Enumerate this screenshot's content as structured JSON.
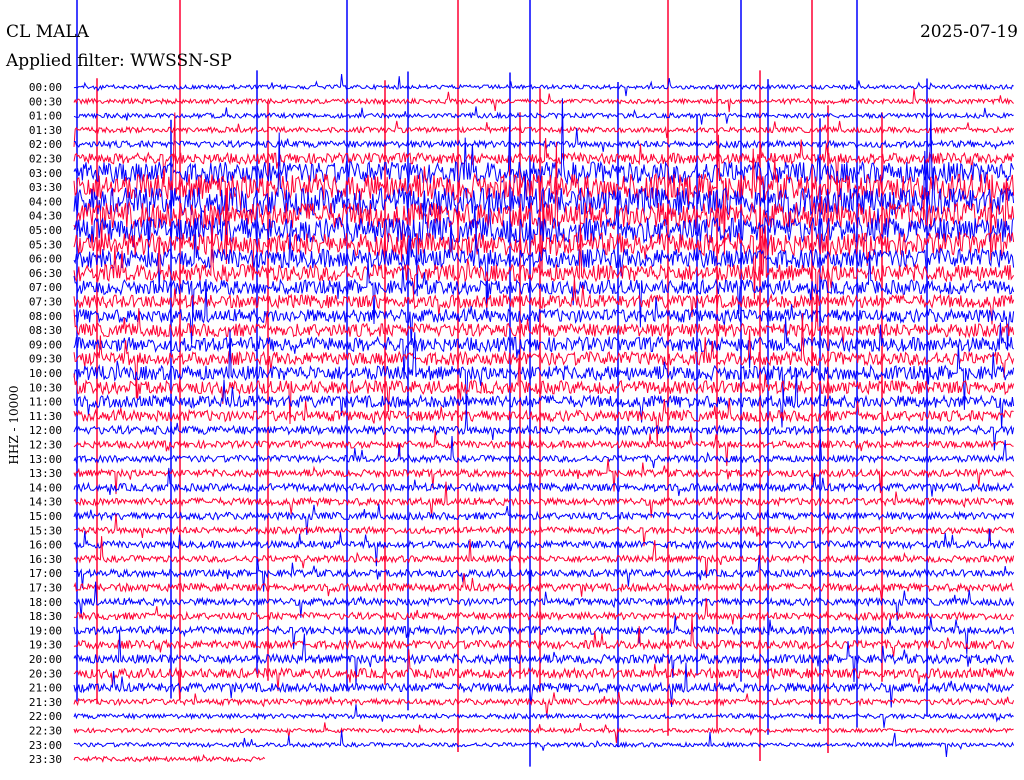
{
  "header": {
    "station": "CL MALA",
    "date": "2025-07-19",
    "filter": "Applied filter: WWSSN-SP"
  },
  "channel_label": "HHZ - 10000",
  "colors": {
    "odd_trace": "#0000ff",
    "even_trace": "#ff0033",
    "background": "#ffffff",
    "text": "#000000"
  },
  "chart_data": {
    "type": "line",
    "subtype": "helicorder",
    "title": "CL MALA",
    "ylabel": "HHZ - 10000",
    "tick_labels": [
      "00:00",
      "00:30",
      "01:00",
      "01:30",
      "02:00",
      "02:30",
      "03:00",
      "03:30",
      "04:00",
      "04:30",
      "05:00",
      "05:30",
      "06:00",
      "06:30",
      "07:00",
      "07:30",
      "08:00",
      "08:30",
      "09:00",
      "09:30",
      "10:00",
      "10:30",
      "11:00",
      "11:30",
      "12:00",
      "12:30",
      "13:00",
      "13:30",
      "14:00",
      "14:30",
      "15:00",
      "15:30",
      "16:00",
      "16:30",
      "17:00",
      "17:30",
      "18:00",
      "18:30",
      "19:00",
      "19:30",
      "20:00",
      "20:30",
      "21:00",
      "21:30",
      "22:00",
      "22:30",
      "23:00",
      "23:30"
    ],
    "row_minutes": 30,
    "series_colors": [
      "#0000ff",
      "#ff0033"
    ],
    "relative_noise_amplitude": [
      0.35,
      0.4,
      0.4,
      0.45,
      0.55,
      0.9,
      1.8,
      2.2,
      2.3,
      2.2,
      2.1,
      1.9,
      1.6,
      1.4,
      1.2,
      1.1,
      1.1,
      1.1,
      1.2,
      1.1,
      1.2,
      1.1,
      1.0,
      0.9,
      0.7,
      0.6,
      0.55,
      0.6,
      0.65,
      0.6,
      0.6,
      0.55,
      0.6,
      0.55,
      0.6,
      0.65,
      0.6,
      0.6,
      0.65,
      0.7,
      0.75,
      0.8,
      0.75,
      0.5,
      0.4,
      0.35,
      0.35,
      0.4
    ]
  }
}
